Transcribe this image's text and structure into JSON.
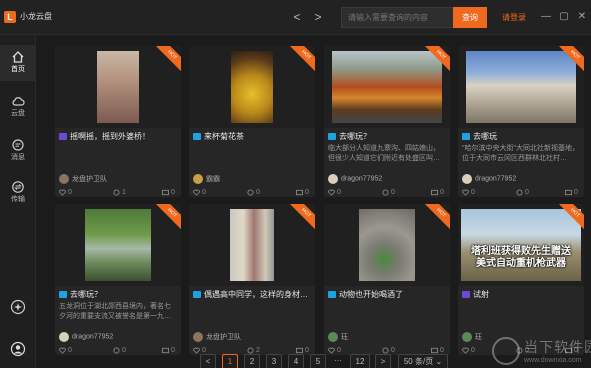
{
  "app": {
    "logo_char": "L",
    "name": "小龙云盘"
  },
  "header": {
    "back_glyph": "<",
    "forward_glyph": ">",
    "search_placeholder": "请输入需要查询的内容",
    "search_button": "查询",
    "login": "请登录",
    "minimize_glyph": "—",
    "maximize_glyph": "▢",
    "close_glyph": "✕"
  },
  "sidebar": {
    "items": [
      {
        "label": "首页",
        "icon": "home-icon"
      },
      {
        "label": "云盘",
        "icon": "cloud-icon"
      },
      {
        "label": "消息",
        "icon": "message-icon"
      },
      {
        "label": "传输",
        "icon": "transfer-icon"
      }
    ],
    "bottom": [
      {
        "icon": "plugin-icon"
      },
      {
        "icon": "user-icon"
      }
    ]
  },
  "cards": [
    {
      "hot": "HOT",
      "tag_color": "purple",
      "title": "摇啊摇，摇到外婆桥！",
      "desc": "",
      "author": "龙盘护卫队",
      "likes": "0",
      "views": "1",
      "saves": "0"
    },
    {
      "hot": "HOT",
      "tag_color": "blue",
      "title": "来杯菊花茶",
      "desc": "",
      "author": "霸霸",
      "likes": "0",
      "views": "0",
      "saves": "0"
    },
    {
      "hot": "HOT",
      "tag_color": "blue",
      "title": "去哪玩？",
      "desc": "临大部分人知道九寨沟、四姑娘山，但很少人知道它们附近有处盛区叫…",
      "author": "dragon77952",
      "likes": "0",
      "views": "0",
      "saves": "0"
    },
    {
      "hot": "HOT",
      "tag_color": "blue",
      "title": "去哪玩",
      "desc": "\"哈尔滨中央大街\"大同北社新视基地，位于大同市云冈区西群林北社村…",
      "author": "dragon77952",
      "likes": "0",
      "views": "0",
      "saves": "0"
    },
    {
      "hot": "HOT",
      "tag_color": "blue",
      "title": "去哪玩？",
      "desc": "五龙洞位于湖北郧西县境内，著名七夕河的重要支流又被誉名是第一九…",
      "author": "dragon77952",
      "likes": "0",
      "views": "0",
      "saves": "0"
    },
    {
      "hot": "HOT",
      "tag_color": "blue",
      "title": "偶遇高中同学，这样的身材…",
      "desc": "",
      "author": "龙盘护卫队",
      "likes": "0",
      "views": "2",
      "saves": "0"
    },
    {
      "hot": "HOT",
      "tag_color": "blue",
      "title": "动物也开始喝酒了",
      "desc": "",
      "author": "珏",
      "likes": "0",
      "views": "0",
      "saves": "0"
    },
    {
      "hot": "HOT",
      "tag_color": "purple",
      "title": "试射",
      "desc": "",
      "author": "珏",
      "likes": "0",
      "views": "0",
      "saves": "0",
      "overlay1": "塔利班获得败先生赠送",
      "overlay2": "美式自动重机枪武器"
    }
  ],
  "pager": {
    "prev": "<",
    "pages": [
      "1",
      "2",
      "3",
      "4",
      "5"
    ],
    "ellipsis": "···",
    "last": "12",
    "next": ">",
    "page_size": "50 条/页",
    "current": "1"
  },
  "watermark": {
    "text": "当下软件园",
    "url": "www.downxia.com"
  },
  "colors": {
    "accent": "#ef6a1f",
    "tag_blue": "#1fa3e0",
    "tag_purple": "#6c4ad6"
  }
}
